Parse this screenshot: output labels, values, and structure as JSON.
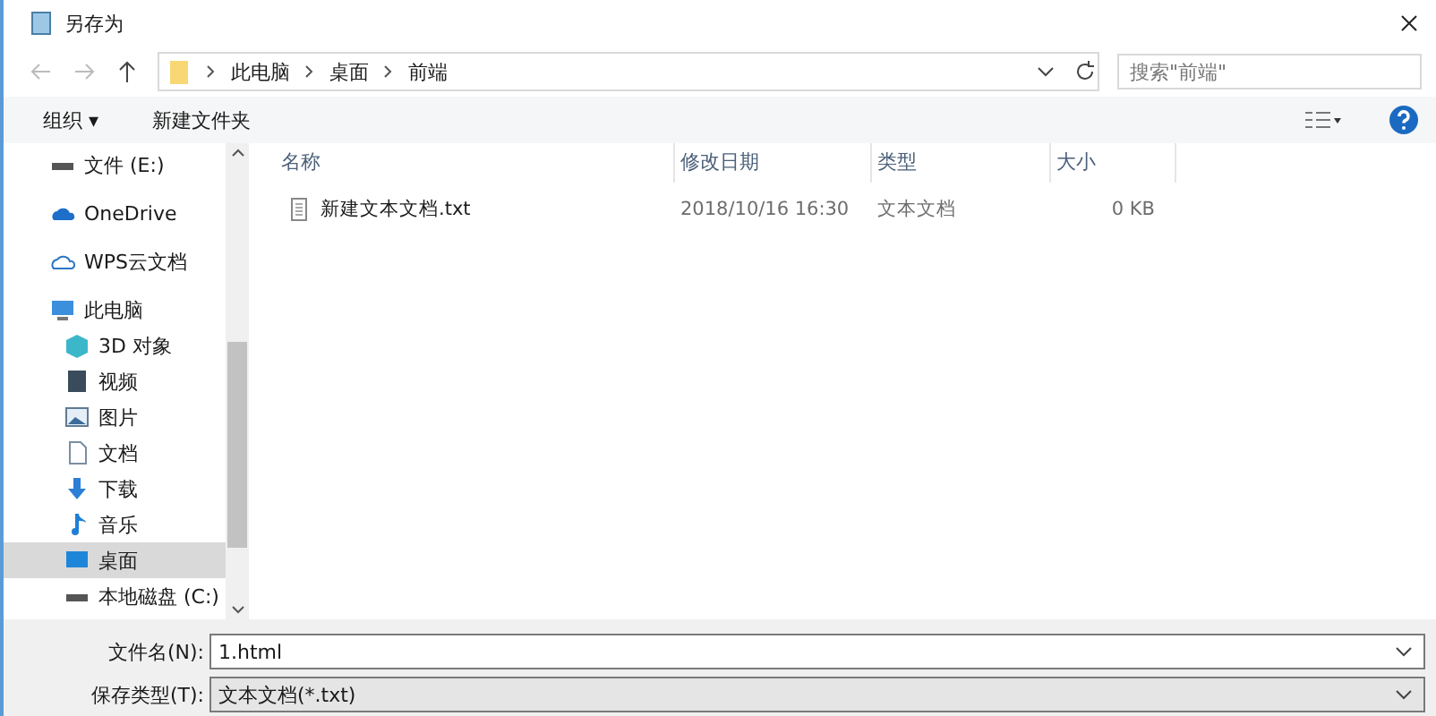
{
  "window": {
    "title": "另存为"
  },
  "address": {
    "crumbs": [
      "此电脑",
      "桌面",
      "前端"
    ],
    "search_placeholder": "搜索\"前端\""
  },
  "toolbar": {
    "organize": "组织 ▾",
    "new_folder": "新建文件夹"
  },
  "sidebar": {
    "items": [
      {
        "label": "文件 (E:)",
        "kind": "drive",
        "selected": false
      },
      {
        "label": "OneDrive",
        "kind": "cloud",
        "selected": false
      },
      {
        "label": "WPS云文档",
        "kind": "cloud-outline",
        "selected": false
      },
      {
        "label": "此电脑",
        "kind": "pc",
        "selected": false,
        "children": [
          {
            "label": "3D 对象",
            "kind": "cube",
            "selected": false
          },
          {
            "label": "视频",
            "kind": "video",
            "selected": false
          },
          {
            "label": "图片",
            "kind": "image",
            "selected": false
          },
          {
            "label": "文档",
            "kind": "doc",
            "selected": false
          },
          {
            "label": "下载",
            "kind": "download",
            "selected": false
          },
          {
            "label": "音乐",
            "kind": "music",
            "selected": false
          },
          {
            "label": "桌面",
            "kind": "desktop",
            "selected": true
          },
          {
            "label": "本地磁盘 (C:)",
            "kind": "drive",
            "selected": false
          }
        ]
      }
    ]
  },
  "table": {
    "columns": [
      "名称",
      "修改日期",
      "类型",
      "大小"
    ],
    "rows": [
      {
        "name": "新建文本文档.txt",
        "modified": "2018/10/16 16:30",
        "type": "文本文档",
        "size": "0 KB"
      }
    ]
  },
  "form": {
    "filename_label": "文件名(N):",
    "filename": "1.html",
    "type_label": "保存类型(T):",
    "type": "文本文档(*.txt)"
  }
}
